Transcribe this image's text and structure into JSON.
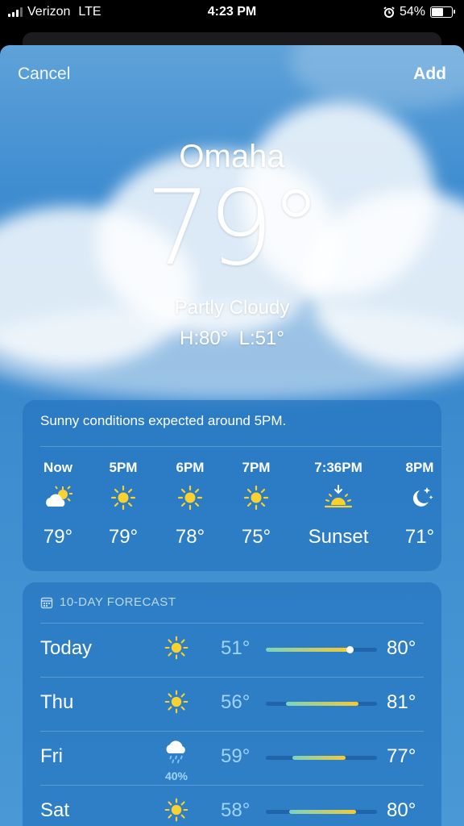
{
  "status": {
    "carrier": "Verizon",
    "network": "LTE",
    "time": "4:23 PM",
    "battery": "54%"
  },
  "nav": {
    "cancel": "Cancel",
    "add": "Add"
  },
  "location": {
    "city": "Omaha",
    "temp": "79°",
    "condition": "Partly Cloudy",
    "hilo": "H:80°  L:51°"
  },
  "hourly": {
    "summary": "Sunny conditions expected around 5PM.",
    "items": [
      {
        "time": "Now",
        "icon": "partly-cloudy-icon",
        "value": "79°"
      },
      {
        "time": "5PM",
        "icon": "sun-icon",
        "value": "79°"
      },
      {
        "time": "6PM",
        "icon": "sun-icon",
        "value": "78°"
      },
      {
        "time": "7PM",
        "icon": "sun-icon",
        "value": "75°"
      },
      {
        "time": "7:36PM",
        "icon": "sunset-icon",
        "value": "Sunset"
      },
      {
        "time": "8PM",
        "icon": "moon-stars-icon",
        "value": "71°"
      }
    ]
  },
  "forecast": {
    "title": "10-DAY FORECAST",
    "days": [
      {
        "day": "Today",
        "icon": "sun-icon",
        "precip": "",
        "low": "51°",
        "high": "80°",
        "bar_start": 0.0,
        "bar_end": 0.75,
        "current": 0.75
      },
      {
        "day": "Thu",
        "icon": "sun-icon",
        "precip": "",
        "low": "56°",
        "high": "81°",
        "bar_start": 0.18,
        "bar_end": 0.83
      },
      {
        "day": "Fri",
        "icon": "cloud-rain-icon",
        "precip": "40%",
        "low": "59°",
        "high": "77°",
        "bar_start": 0.24,
        "bar_end": 0.72
      },
      {
        "day": "Sat",
        "icon": "sun-icon",
        "precip": "",
        "low": "58°",
        "high": "80°",
        "bar_start": 0.21,
        "bar_end": 0.81
      }
    ]
  },
  "colors": {
    "bar_cool": "#7bd3c2",
    "bar_warm": "#f8c92e",
    "sun": "#f9d22f",
    "low_temp": "#9fd3ff"
  }
}
